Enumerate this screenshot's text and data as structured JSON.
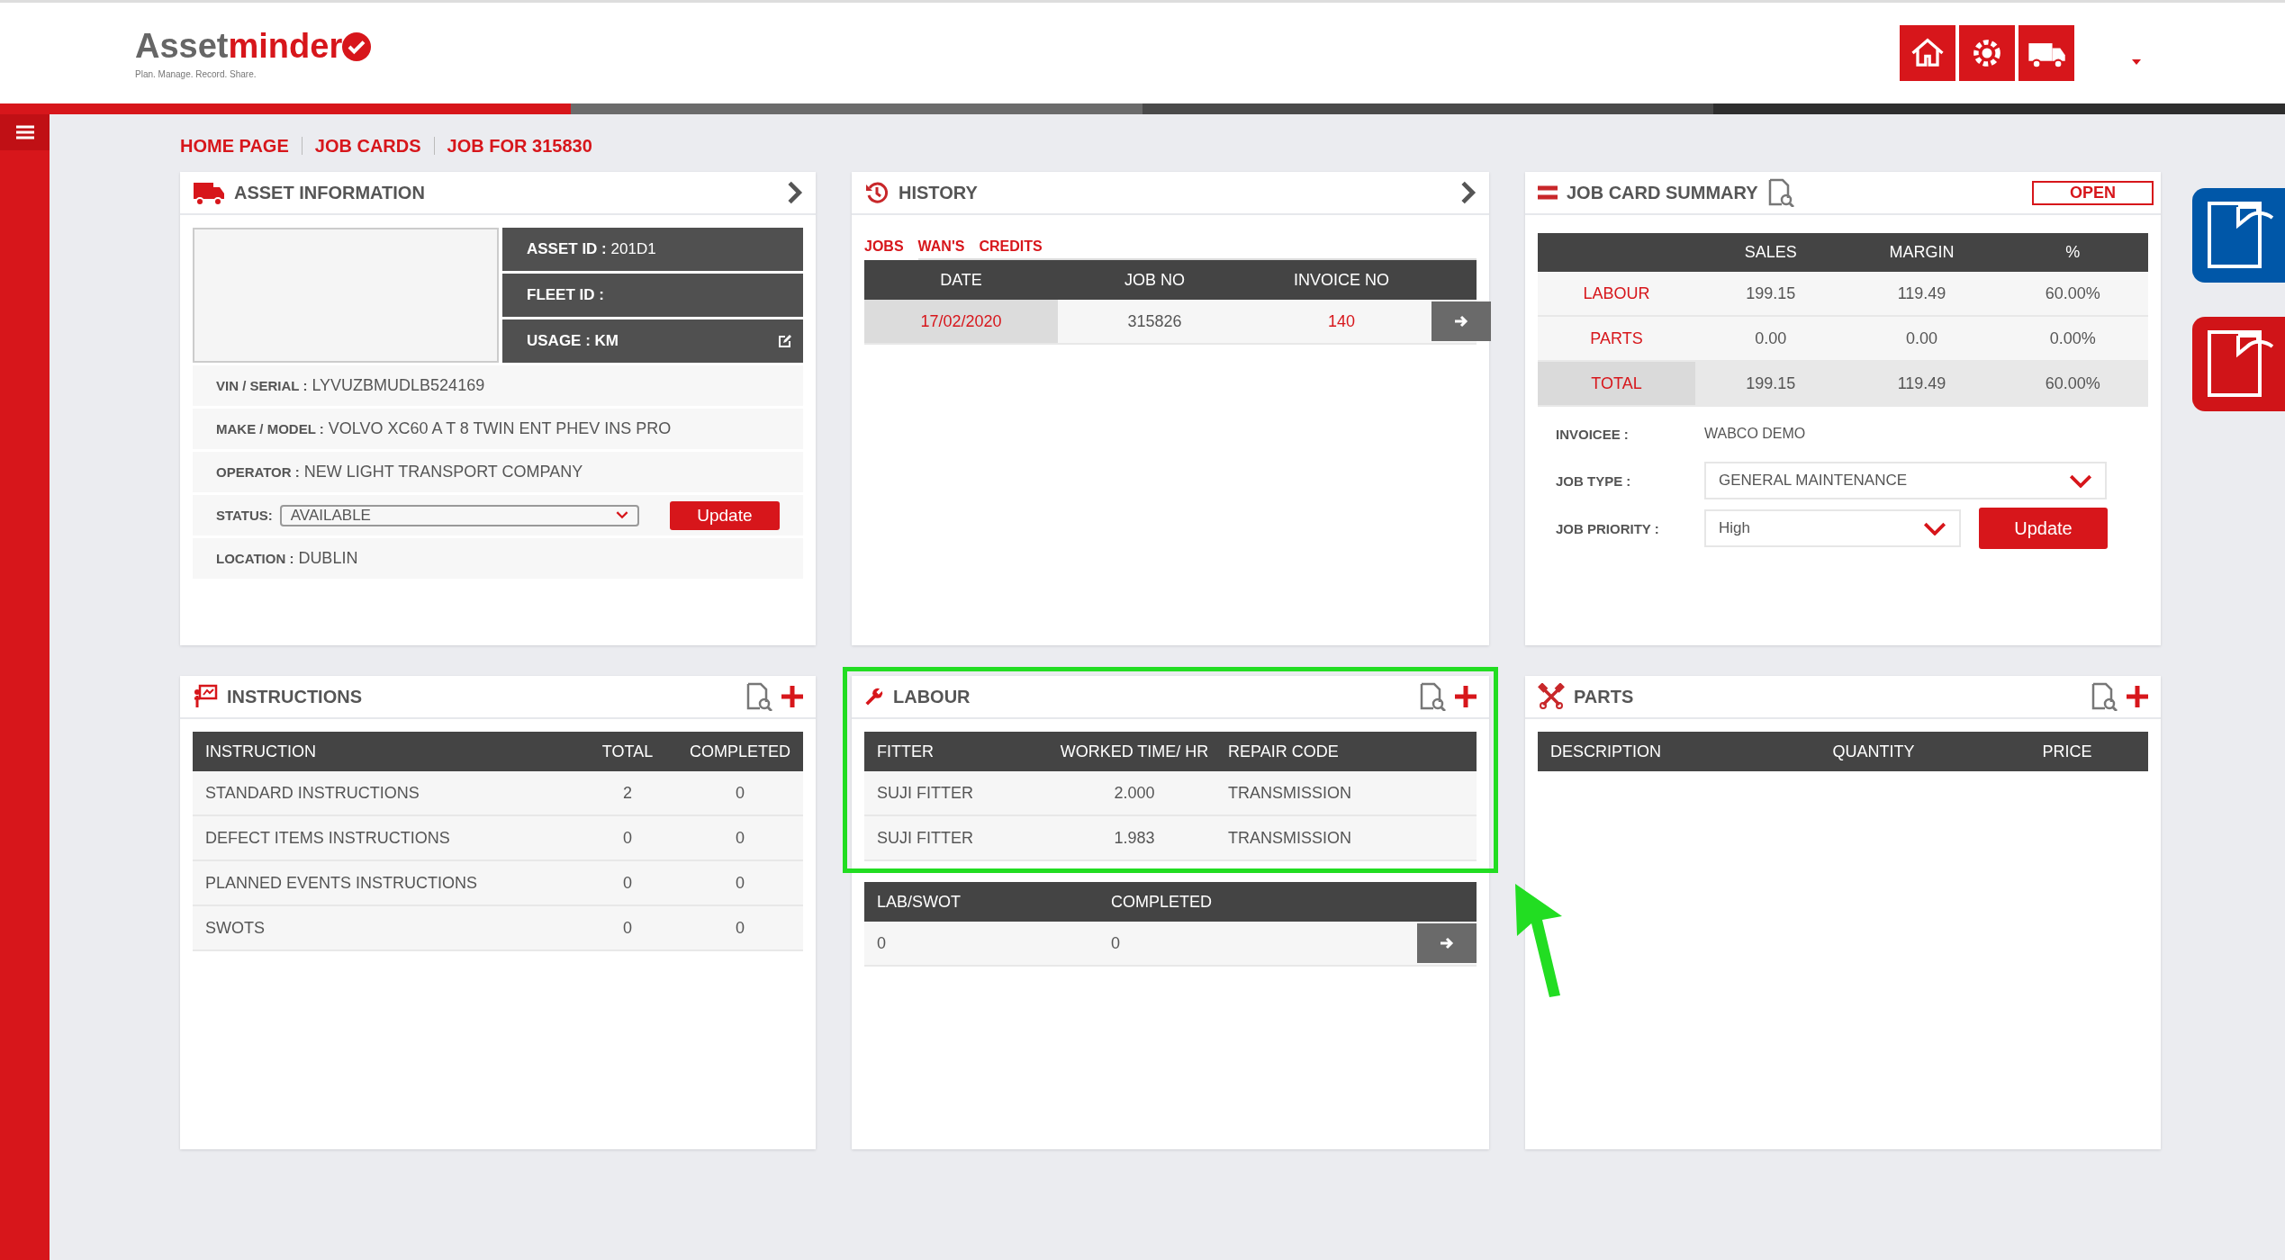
{
  "header": {
    "logo": {
      "name_start": "Asset",
      "name_end": "minder",
      "tagline": "Plan. Manage. Record. Share."
    }
  },
  "breadcrumb": [
    "HOME PAGE",
    "JOB CARDS",
    "JOB FOR 315830"
  ],
  "side_actions": [
    {
      "color": "#0057a8"
    },
    {
      "color": "#d01418"
    }
  ],
  "asset_information": {
    "title": "ASSET INFORMATION",
    "id_fields": [
      {
        "kind": "plain",
        "label": "ASSET ID :",
        "value": "201D1"
      },
      {
        "kind": "plain",
        "label": "FLEET ID :"
      },
      {
        "kind": "editable",
        "label": "USAGE : KM"
      }
    ],
    "details": [
      {
        "kind": "text",
        "label": "VIN / SERIAL :",
        "value": "LYVUZBMUDLB524169"
      },
      {
        "kind": "text",
        "label": "MAKE / MODEL :",
        "value": "VOLVO XC60 A T 8 TWIN ENT PHEV INS PRO"
      },
      {
        "kind": "text",
        "label": "OPERATOR :",
        "value": "NEW LIGHT TRANSPORT COMPANY"
      },
      {
        "kind": "select",
        "label": "STATUS:",
        "value": "AVAILABLE",
        "button": "Update"
      },
      {
        "kind": "text",
        "label": "LOCATION :",
        "value": "DUBLIN"
      }
    ]
  },
  "history": {
    "title": "HISTORY",
    "tabs": [
      {
        "label": "JOBS",
        "selected": true
      },
      {
        "label": "WAN'S",
        "selected": false
      },
      {
        "label": "CREDITS",
        "selected": false
      }
    ],
    "columns": [
      "DATE",
      "JOB NO",
      "INVOICE NO"
    ],
    "rows": [
      {
        "date": "17/02/2020",
        "job_no": "315826",
        "invoice_no": "140"
      }
    ]
  },
  "job_card_summary": {
    "title": "JOB CARD SUMMARY",
    "status": "OPEN",
    "columns": [
      "SALES",
      "MARGIN",
      "%"
    ],
    "rows": [
      {
        "kind": "item",
        "label": "LABOUR",
        "values": [
          "199.15",
          "119.49",
          "60.00%"
        ]
      },
      {
        "kind": "item",
        "label": "PARTS",
        "values": [
          "0.00",
          "0.00",
          "0.00%"
        ]
      },
      {
        "kind": "total",
        "label": "TOTAL",
        "values": [
          "199.15",
          "119.49",
          "60.00%"
        ]
      }
    ],
    "invoicee": {
      "label": "INVOICEE :",
      "value": "WABCO DEMO"
    },
    "job_type": {
      "label": "JOB TYPE :",
      "value": "GENERAL MAINTENANCE"
    },
    "job_priority": {
      "label": "JOB PRIORITY :",
      "value": "High"
    },
    "button": "Update"
  },
  "instructions": {
    "title": "INSTRUCTIONS",
    "columns": [
      "INSTRUCTION",
      "TOTAL",
      "COMPLETED"
    ],
    "rows": [
      [
        "STANDARD INSTRUCTIONS",
        "2",
        "0"
      ],
      [
        "DEFECT ITEMS INSTRUCTIONS",
        "0",
        "0"
      ],
      [
        "PLANNED EVENTS INSTRUCTIONS",
        "0",
        "0"
      ],
      [
        "SWOTS",
        "0",
        "0"
      ]
    ]
  },
  "labour": {
    "title": "LABOUR",
    "highlighted": true,
    "columns": [
      "FITTER",
      "WORKED TIME/ HR",
      "REPAIR CODE"
    ],
    "rows": [
      [
        "SUJI FITTER",
        "2.000",
        "TRANSMISSION"
      ],
      [
        "SUJI FITTER",
        "1.983",
        "TRANSMISSION"
      ]
    ],
    "swot": {
      "columns": [
        "LAB/SWOT",
        "COMPLETED"
      ],
      "rows": [
        [
          "0",
          "0"
        ]
      ]
    }
  },
  "parts": {
    "title": "PARTS",
    "columns": [
      "DESCRIPTION",
      "QUANTITY",
      "PRICE"
    ]
  }
}
